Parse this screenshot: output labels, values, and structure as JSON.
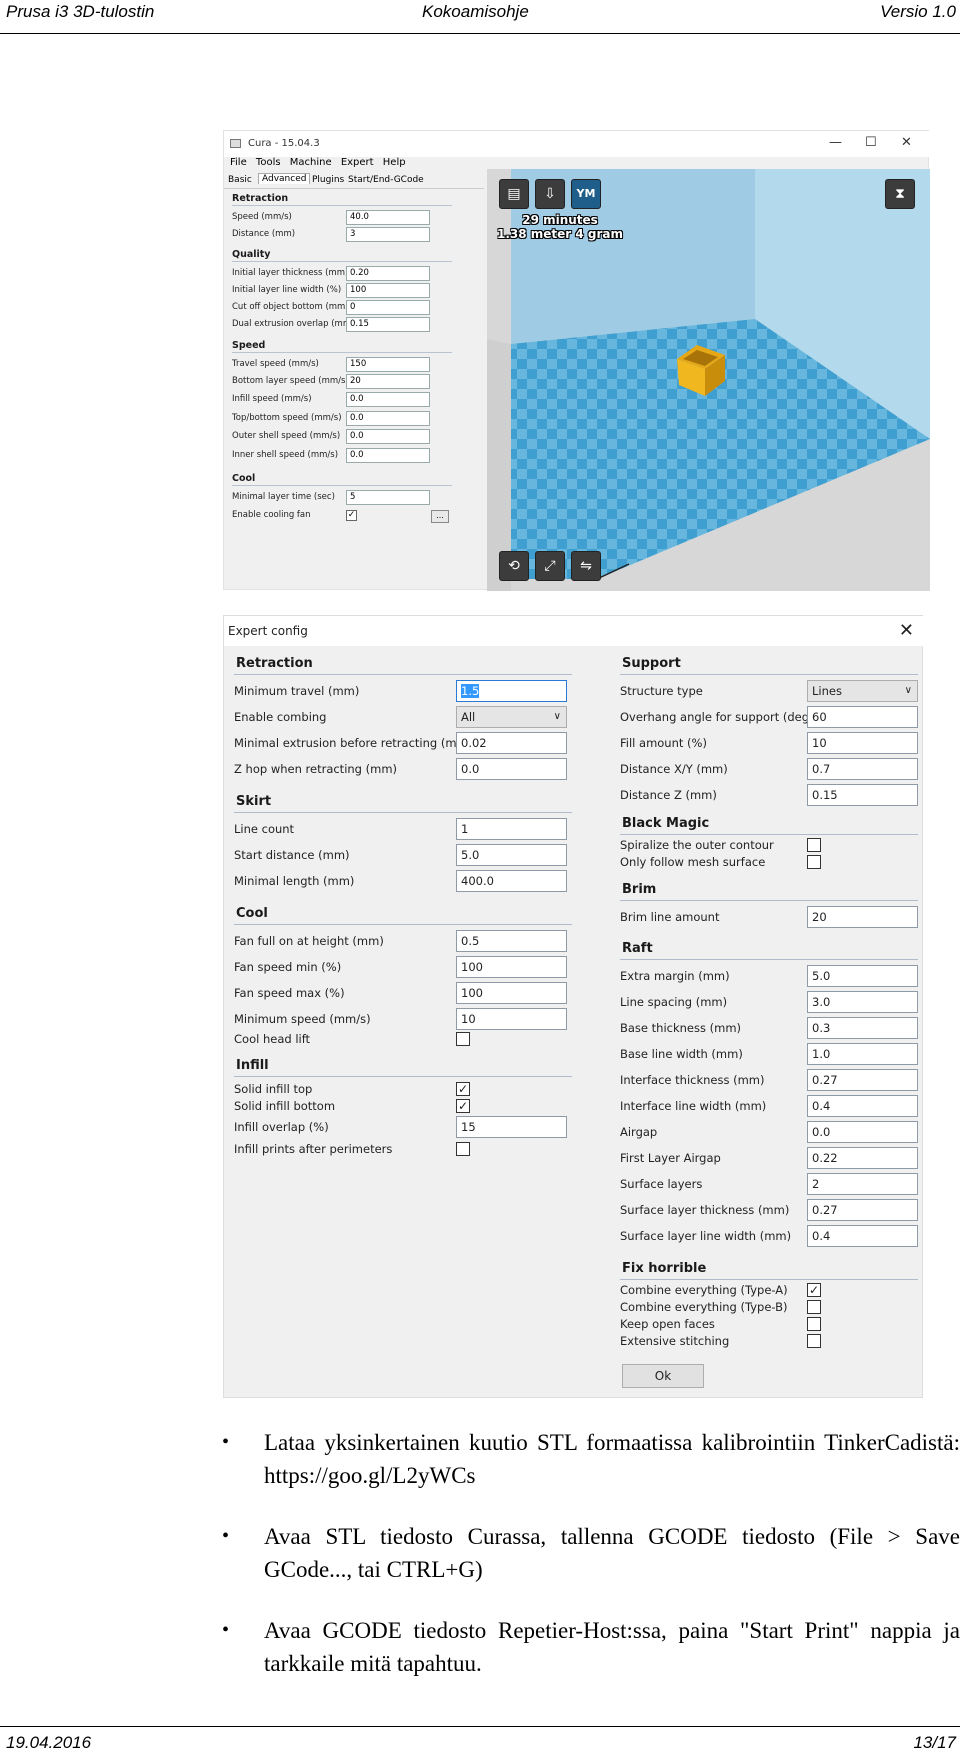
{
  "header": {
    "left": "Prusa i3 3D-tulostin",
    "center": "Kokoamisohje",
    "right": "Versio 1.0"
  },
  "footer": {
    "date": "19.04.2016",
    "page": "13/17"
  },
  "cura": {
    "title": "Cura - 15.04.3",
    "window_controls": {
      "minimize": "—",
      "maximize": "☐",
      "close": "✕"
    },
    "menu": [
      "File",
      "Tools",
      "Machine",
      "Expert",
      "Help"
    ],
    "tabs": [
      "Basic",
      "Advanced",
      "Plugins",
      "Start/End-GCode"
    ],
    "active_tab": "Advanced",
    "sections": {
      "retraction": "Retraction",
      "quality": "Quality",
      "speed": "Speed",
      "cool": "Cool"
    },
    "fields": [
      {
        "label": "Speed (mm/s)",
        "value": "40.0"
      },
      {
        "label": "Distance (mm)",
        "value": "3"
      },
      {
        "label": "Initial layer thickness (mm)",
        "value": "0.20"
      },
      {
        "label": "Initial layer line width (%)",
        "value": "100"
      },
      {
        "label": "Cut off object bottom (mm)",
        "value": "0"
      },
      {
        "label": "Dual extrusion overlap (mm)",
        "value": "0.15"
      },
      {
        "label": "Travel speed (mm/s)",
        "value": "150"
      },
      {
        "label": "Bottom layer speed (mm/s)",
        "value": "20"
      },
      {
        "label": "Infill speed (mm/s)",
        "value": "0.0"
      },
      {
        "label": "Top/bottom speed (mm/s)",
        "value": "0.0"
      },
      {
        "label": "Outer shell speed (mm/s)",
        "value": "0.0"
      },
      {
        "label": "Inner shell speed (mm/s)",
        "value": "0.0"
      },
      {
        "label": "Minimal layer time (sec)",
        "value": "5"
      }
    ],
    "cooling_fan_label": "Enable cooling fan",
    "cooling_fan_checked": "✓",
    "dots_button": "...",
    "estimate_line1": "29 minutes",
    "estimate_line2": "1.38 meter 4 gram",
    "ym_button": "YM"
  },
  "expert": {
    "title": "Expert config",
    "close": "✕",
    "left": {
      "retraction": {
        "heading": "Retraction",
        "min_travel": {
          "label": "Minimum travel (mm)",
          "value": "1.5"
        },
        "combing": {
          "label": "Enable combing",
          "value": "All"
        },
        "min_extrusion": {
          "label": "Minimal extrusion before retracting (mm)",
          "value": "0.02"
        },
        "zhop": {
          "label": "Z hop when retracting (mm)",
          "value": "0.0"
        }
      },
      "skirt": {
        "heading": "Skirt",
        "line_count": {
          "label": "Line count",
          "value": "1"
        },
        "start_distance": {
          "label": "Start distance (mm)",
          "value": "5.0"
        },
        "min_length": {
          "label": "Minimal length (mm)",
          "value": "400.0"
        }
      },
      "cool": {
        "heading": "Cool",
        "fan_full": {
          "label": "Fan full on at height (mm)",
          "value": "0.5"
        },
        "fan_min": {
          "label": "Fan speed min (%)",
          "value": "100"
        },
        "fan_max": {
          "label": "Fan speed max (%)",
          "value": "100"
        },
        "min_speed": {
          "label": "Minimum speed (mm/s)",
          "value": "10"
        },
        "head_lift": {
          "label": "Cool head lift",
          "checked": ""
        }
      },
      "infill": {
        "heading": "Infill",
        "solid_top": {
          "label": "Solid infill top",
          "checked": "✓"
        },
        "solid_bottom": {
          "label": "Solid infill bottom",
          "checked": "✓"
        },
        "overlap": {
          "label": "Infill overlap (%)",
          "value": "15"
        },
        "after_perimeters": {
          "label": "Infill prints after perimeters",
          "checked": ""
        }
      }
    },
    "right": {
      "support": {
        "heading": "Support",
        "structure": {
          "label": "Structure type",
          "value": "Lines"
        },
        "overhang": {
          "label": "Overhang angle for support (deg)",
          "value": "60"
        },
        "fill": {
          "label": "Fill amount (%)",
          "value": "10"
        },
        "dist_xy": {
          "label": "Distance X/Y (mm)",
          "value": "0.7"
        },
        "dist_z": {
          "label": "Distance Z (mm)",
          "value": "0.15"
        }
      },
      "black_magic": {
        "heading": "Black Magic",
        "spiralize": {
          "label": "Spiralize the outer contour",
          "checked": ""
        },
        "mesh_surface": {
          "label": "Only follow mesh surface",
          "checked": ""
        }
      },
      "brim": {
        "heading": "Brim",
        "line_amount": {
          "label": "Brim line amount",
          "value": "20"
        }
      },
      "raft": {
        "heading": "Raft",
        "rows": [
          {
            "label": "Extra margin (mm)",
            "value": "5.0"
          },
          {
            "label": "Line spacing (mm)",
            "value": "3.0"
          },
          {
            "label": "Base thickness (mm)",
            "value": "0.3"
          },
          {
            "label": "Base line width (mm)",
            "value": "1.0"
          },
          {
            "label": "Interface thickness (mm)",
            "value": "0.27"
          },
          {
            "label": "Interface line width (mm)",
            "value": "0.4"
          },
          {
            "label": "Airgap",
            "value": "0.0"
          },
          {
            "label": "First Layer Airgap",
            "value": "0.22"
          },
          {
            "label": "Surface layers",
            "value": "2"
          },
          {
            "label": "Surface layer thickness (mm)",
            "value": "0.27"
          },
          {
            "label": "Surface layer line width (mm)",
            "value": "0.4"
          }
        ]
      },
      "fix_horrible": {
        "heading": "Fix horrible",
        "rows": [
          {
            "label": "Combine everything (Type-A)",
            "checked": "✓"
          },
          {
            "label": "Combine everything (Type-B)",
            "checked": ""
          },
          {
            "label": "Keep open faces",
            "checked": ""
          },
          {
            "label": "Extensive stitching",
            "checked": ""
          }
        ]
      }
    },
    "ok_label": "Ok"
  },
  "bullets": [
    "Lataa yksinkertainen kuutio STL formaatissa kalibrointiin TinkerCadistä: https://goo.gl/L2yWCs",
    "Avaa STL tiedosto Curassa, tallenna GCODE tiedosto (File > Save GCode..., tai CTRL+G)",
    "Avaa GCODE tiedosto Repetier-Host:ssa, paina \"Start Print\" nappia ja tarkkaile mitä tapahtuu."
  ],
  "bullet_symbol": "•"
}
